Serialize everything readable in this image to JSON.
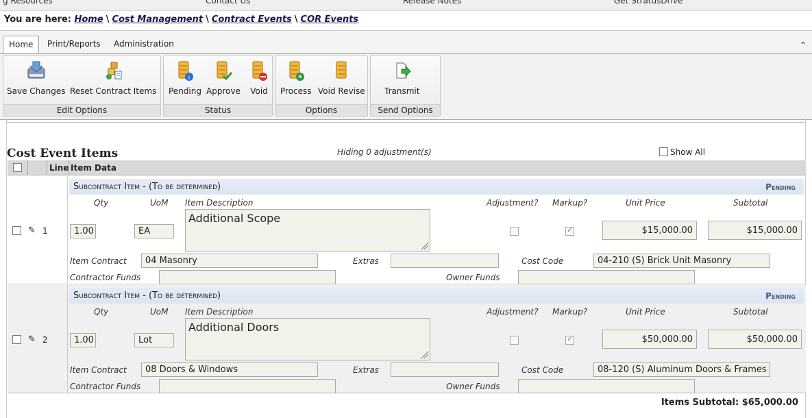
{
  "topnav": {
    "items": [
      "g Resources",
      "Contact Us",
      "Release Notes",
      "Get StratusDrive"
    ]
  },
  "breadcrumb": {
    "prefix": "You are here:",
    "items": [
      "Home",
      "Cost Management",
      "Contract Events",
      "COR Events"
    ],
    "separator": "\\"
  },
  "ribbon": {
    "tabs": [
      "Home",
      "Print/Reports",
      "Administration"
    ],
    "collapse_glyph": "⌃",
    "groups": [
      {
        "name": "Edit Options",
        "buttons": [
          "Save Changes",
          "Reset Contract Items"
        ]
      },
      {
        "name": "Status",
        "buttons": [
          "Pending",
          "Approve",
          "Void"
        ]
      },
      {
        "name": "Options",
        "buttons": [
          "Process",
          "Void Revise"
        ]
      },
      {
        "name": "Send Options",
        "buttons": [
          "Transmit"
        ]
      }
    ]
  },
  "section": {
    "title": "Cost Event Items",
    "hiding": "Hiding 0 adjustment(s)",
    "show_all": "Show All"
  },
  "grid": {
    "headers": {
      "line": "Line",
      "item_data": "Item Data"
    },
    "labels": {
      "qty": "Qty",
      "uom": "UoM",
      "desc": "Item Description",
      "adjustment": "Adjustment?",
      "markup": "Markup?",
      "unit_price": "Unit Price",
      "subtotal": "Subtotal",
      "item_contract": "Item Contract",
      "extras": "Extras",
      "cost_code": "Cost Code",
      "contractor_funds": "Contractor Funds",
      "owner_funds": "Owner Funds"
    },
    "rows": [
      {
        "line": "1",
        "item_title": "Subcontract Item - (To be determined)",
        "status": "Pending",
        "qty": "1.00",
        "uom": "EA",
        "description": "Additional Scope",
        "adjustment": false,
        "markup": true,
        "unit_price": "$15,000.00",
        "subtotal": "$15,000.00",
        "item_contract": "04 Masonry",
        "extras": "",
        "cost_code": "04-210 (S) Brick Unit Masonry",
        "contractor_funds": "",
        "owner_funds": ""
      },
      {
        "line": "2",
        "item_title": "Subcontract Item - (To be determined)",
        "status": "Pending",
        "qty": "1.00",
        "uom": "Lot",
        "description": "Additional Doors",
        "adjustment": false,
        "markup": true,
        "unit_price": "$50,000.00",
        "subtotal": "$50,000.00",
        "item_contract": "08 Doors & Windows",
        "extras": "",
        "cost_code": "08-120 (S) Aluminum Doors & Frames",
        "contractor_funds": "",
        "owner_funds": ""
      }
    ]
  },
  "totals": {
    "label": "Items Subtotal:",
    "value": "$65,000.00"
  },
  "colors": {
    "status_text": "#4a5a80",
    "item_bar": "#e2e8f5"
  }
}
